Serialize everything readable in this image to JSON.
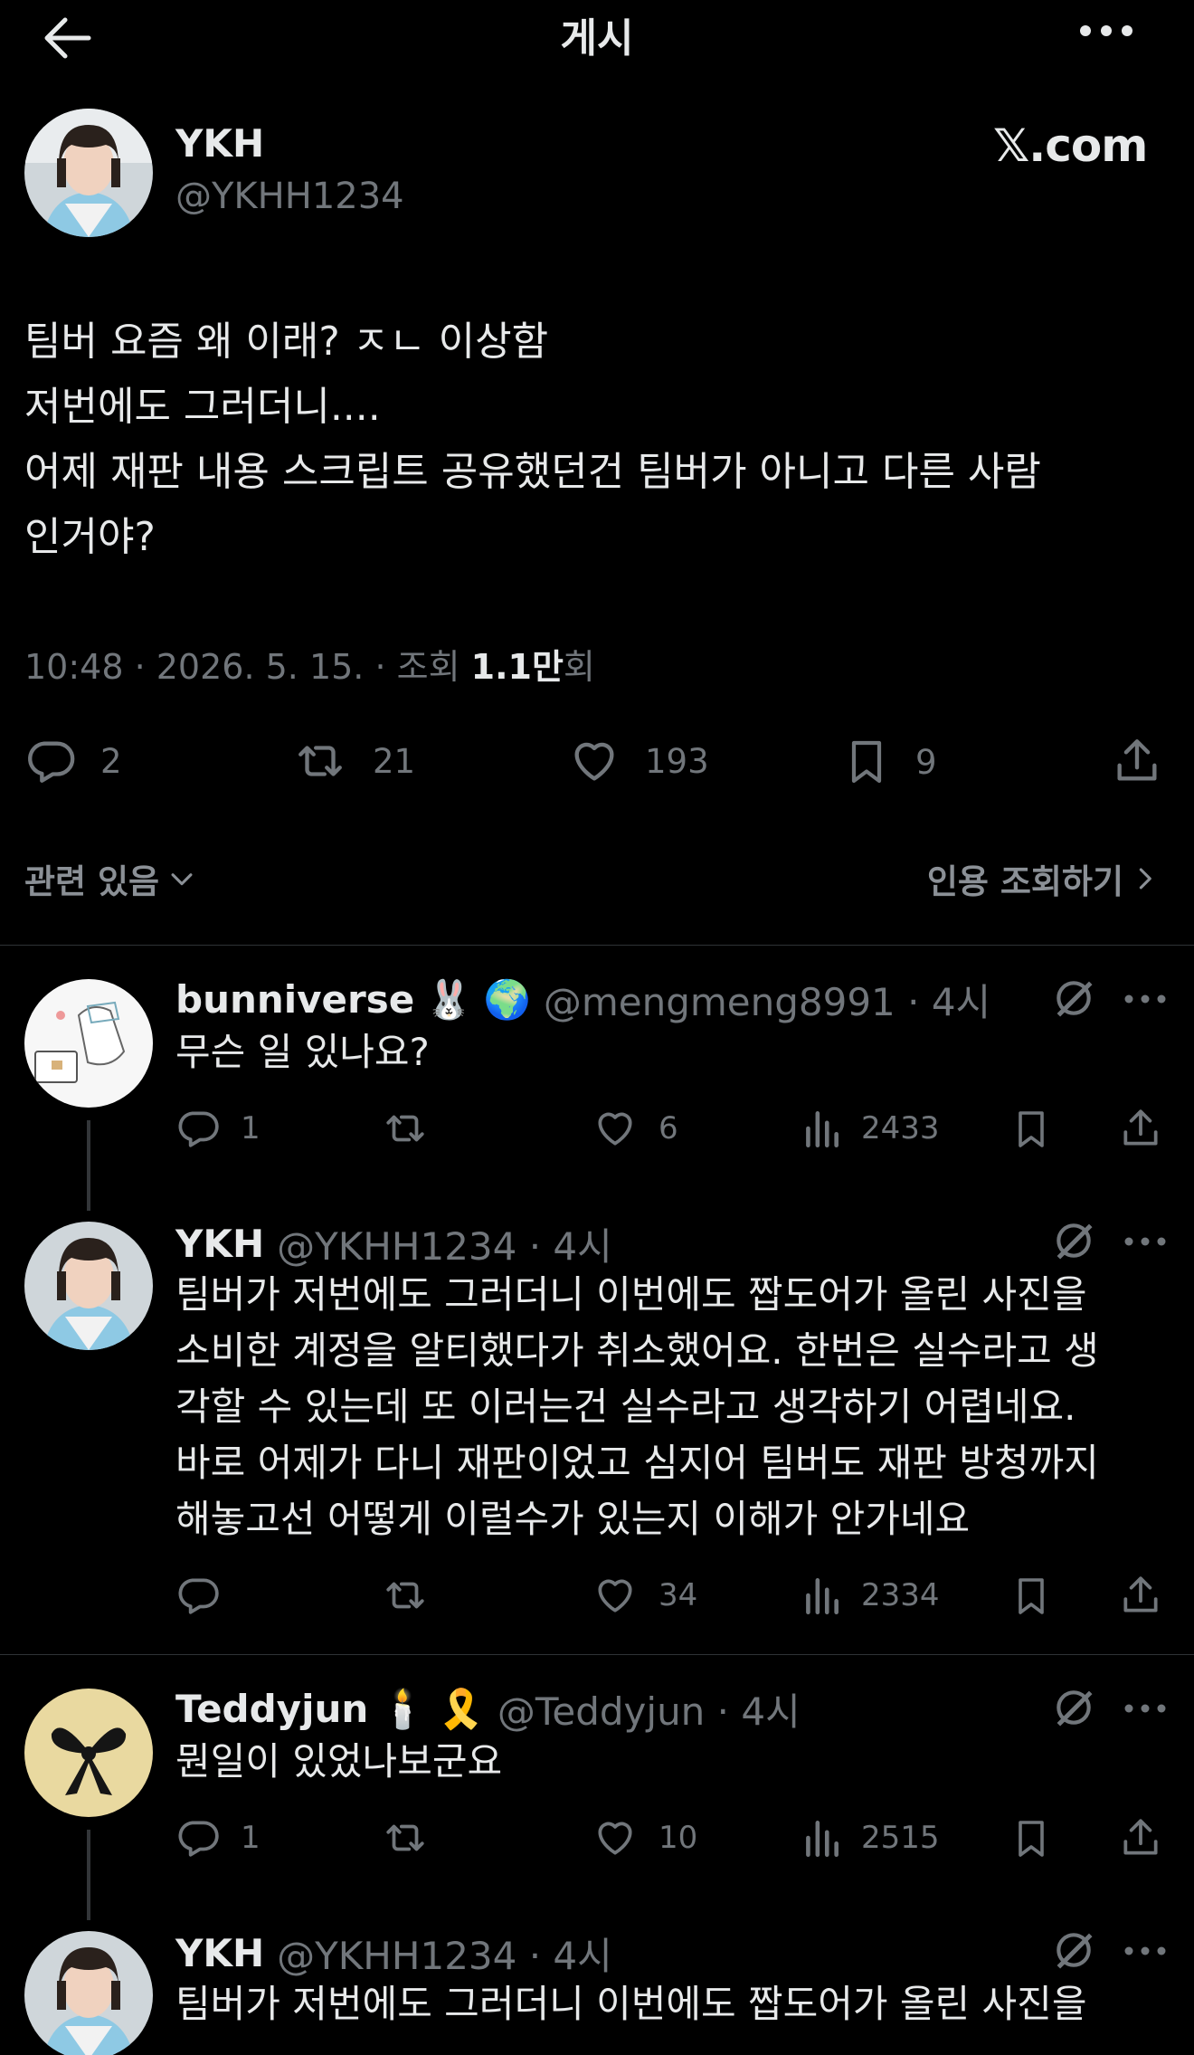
{
  "header": {
    "title": "게시"
  },
  "main_post": {
    "name": "YKH",
    "handle": "@YKHH1234",
    "badge": "𝕏.com",
    "text": "팀버 요즘 왜 이래? ㅈㄴ 이상함\n저번에도 그러더니....\n어제 재판 내용 스크립트 공유했던건 팀버가 아니고 다른 사람\n인거야?",
    "meta_time": "10:48 · 2026. 5. 15. · 조회 ",
    "meta_views": "1.1만",
    "meta_suffix": "회",
    "replies": "2",
    "reposts": "21",
    "likes": "193",
    "bookmarks": "9",
    "related_label": "관련 있음",
    "quotes_label": "인용 조회하기"
  },
  "replies": [
    {
      "name": "bunniverse",
      "emojis": [
        "🐰",
        "🌍"
      ],
      "handle": "@mengmeng8991 · 4시",
      "text": "무슨 일 있나요?",
      "replies": "1",
      "reposts": "",
      "likes": "6",
      "views": "2433"
    },
    {
      "name": "YKH",
      "emojis": [],
      "handle": "@YKHH1234 · 4시",
      "text": "팀버가 저번에도 그러더니 이번에도 짭도어가 올린 사진을\n소비한 계정을 알티했다가 취소했어요. 한번은 실수라고 생\n각할 수 있는데 또 이러는건 실수라고 생각하기 어렵네요.\n바로 어제가 다니 재판이었고 심지어 팀버도 재판 방청까지\n해놓고선 어떻게 이럴수가 있는지 이해가 안가네요",
      "replies": "",
      "reposts": "",
      "likes": "34",
      "views": "2334"
    },
    {
      "name": "Teddyjun",
      "emojis": [
        "🕯️",
        "🎗️"
      ],
      "handle": "@Teddyjun · 4시",
      "text": "뭔일이 있었나보군요",
      "replies": "1",
      "reposts": "",
      "likes": "10",
      "views": "2515"
    },
    {
      "name": "YKH",
      "emojis": [],
      "handle": "@YKHH1234 · 4시",
      "text": "팀버가 저번에도 그러더니 이번에도 짭도어가 올린 사진을"
    }
  ],
  "colors": {
    "background": "#000000",
    "text": "#e7e9ea",
    "muted": "#71767b",
    "divider": "#2f3336"
  }
}
